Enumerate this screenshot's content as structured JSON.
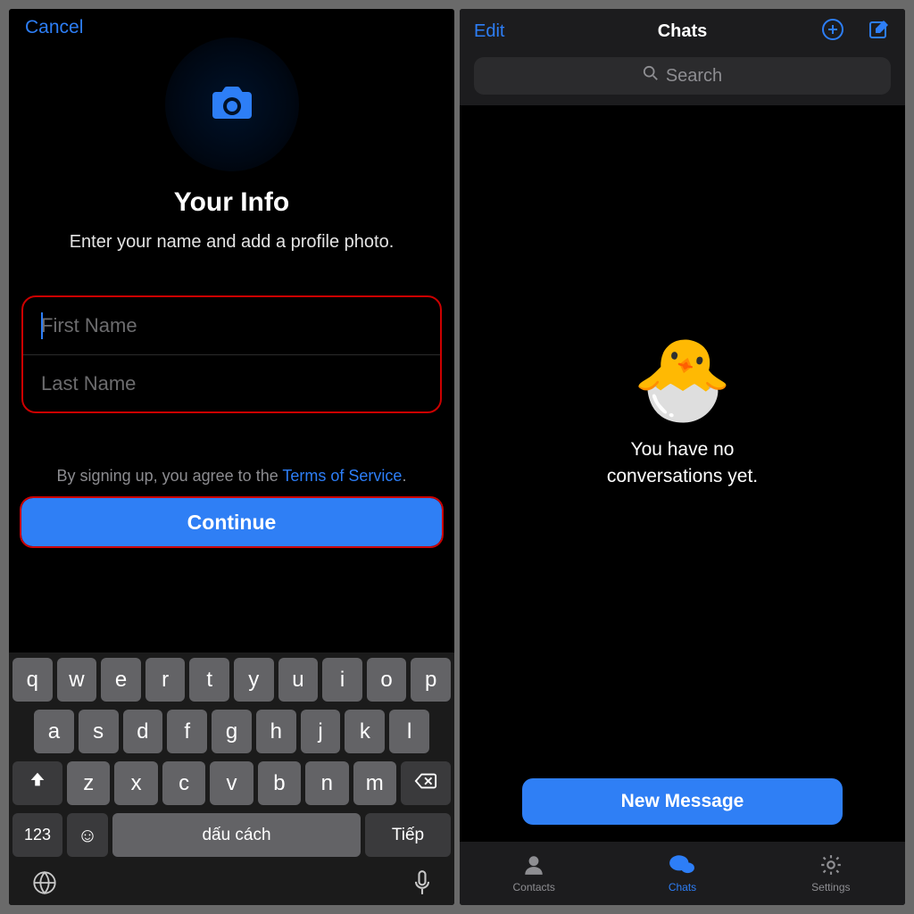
{
  "left": {
    "cancel": "Cancel",
    "heading": "Your Info",
    "subtitle": "Enter your name and add a profile photo.",
    "first_placeholder": "First Name",
    "last_placeholder": "Last Name",
    "tos_prefix": "By signing up, you agree to the ",
    "tos_link": "Terms of Service",
    "tos_suffix": ".",
    "continue": "Continue",
    "keyboard": {
      "rows": [
        [
          "q",
          "w",
          "e",
          "r",
          "t",
          "y",
          "u",
          "i",
          "o",
          "p"
        ],
        [
          "a",
          "s",
          "d",
          "f",
          "g",
          "h",
          "j",
          "k",
          "l"
        ],
        [
          "z",
          "x",
          "c",
          "v",
          "b",
          "n",
          "m"
        ]
      ],
      "numkey": "123",
      "space": "dấu cách",
      "next": "Tiếp"
    }
  },
  "right": {
    "edit": "Edit",
    "title": "Chats",
    "search_placeholder": "Search",
    "empty_line1": "You have no",
    "empty_line2": "conversations yet.",
    "new_message": "New Message",
    "tabs": {
      "contacts": "Contacts",
      "chats": "Chats",
      "settings": "Settings"
    }
  }
}
